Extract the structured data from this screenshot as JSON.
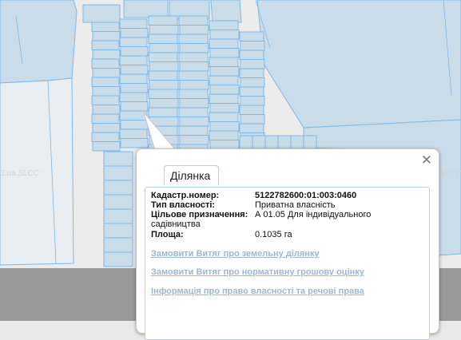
{
  "watermarks": [
    "3.ua.SLCC",
    ".SLCC"
  ],
  "popup": {
    "close_icon": "close-icon",
    "tab_label": "Ділянка",
    "fields": [
      {
        "label": "Кадастр.номер:",
        "value": "5122782600:01:003:0460",
        "bold": true
      },
      {
        "label": "Тип власності:",
        "value": "Приватна власність"
      },
      {
        "label": "Цільове призначення:",
        "value": "А 01.05 Для індивідуального",
        "value_cont": "садівництва"
      },
      {
        "label": "Площа:",
        "value": "0.1035 га"
      }
    ],
    "links": [
      "Замовити Витяг про земельну ділянку",
      "Замовити Витяг про нормативну грошову оцінку",
      "Інформація про право власності та речові права"
    ]
  },
  "colors": {
    "parcel_fill": "#c9dcea",
    "parcel_stroke": "#7fb8e6",
    "map_background": "#ececec",
    "bottom_band": "#999999",
    "link_color": "#9fb6cf"
  }
}
